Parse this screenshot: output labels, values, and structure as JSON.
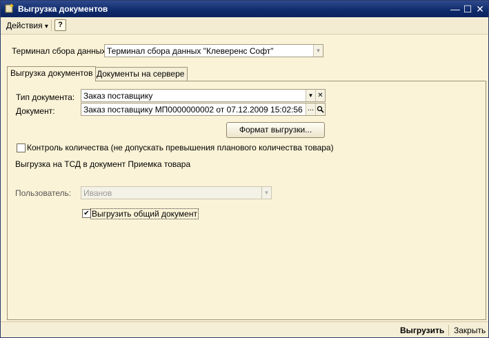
{
  "window": {
    "title": "Выгрузка документов",
    "controls": {
      "minimize": "—",
      "maximize": "☐",
      "close": "✕"
    }
  },
  "toolbar": {
    "actions_label": "Действия",
    "actions_arrow": "▾",
    "help_label": "?"
  },
  "terminal": {
    "label": "Терминал сбора данных:",
    "value": "Терминал сбора данных \"Клеверенс Софт\""
  },
  "tabs": [
    {
      "label": "Выгрузка документов",
      "active": true
    },
    {
      "label": "Документы на сервере",
      "active": false
    }
  ],
  "form": {
    "doc_type_label": "Тип документа:",
    "doc_type_value": "Заказ поставщику",
    "document_label": "Документ:",
    "document_value": "Заказ поставщику МП0000000002 от 07.12.2009 15:02:56",
    "ellipsis": "...",
    "clear": "✕",
    "dropdown": "▼",
    "format_button": "Формат выгрузки...",
    "quantity_control_label": "Контроль количества (не допускать превышения планового количества товара)",
    "quantity_control_checked": false,
    "upload_info": "Выгрузка на ТСД в документ Приемка товара",
    "user_label": "Пользователь:",
    "user_value": "Иванов",
    "common_doc_label": "Выгрузить общий документ",
    "common_doc_checked": true,
    "check_mark": "✔"
  },
  "bottom": {
    "upload_label": "Выгрузить",
    "close_label": "Закрыть"
  },
  "icons": {
    "app": "app-icon",
    "search": "search-icon"
  }
}
